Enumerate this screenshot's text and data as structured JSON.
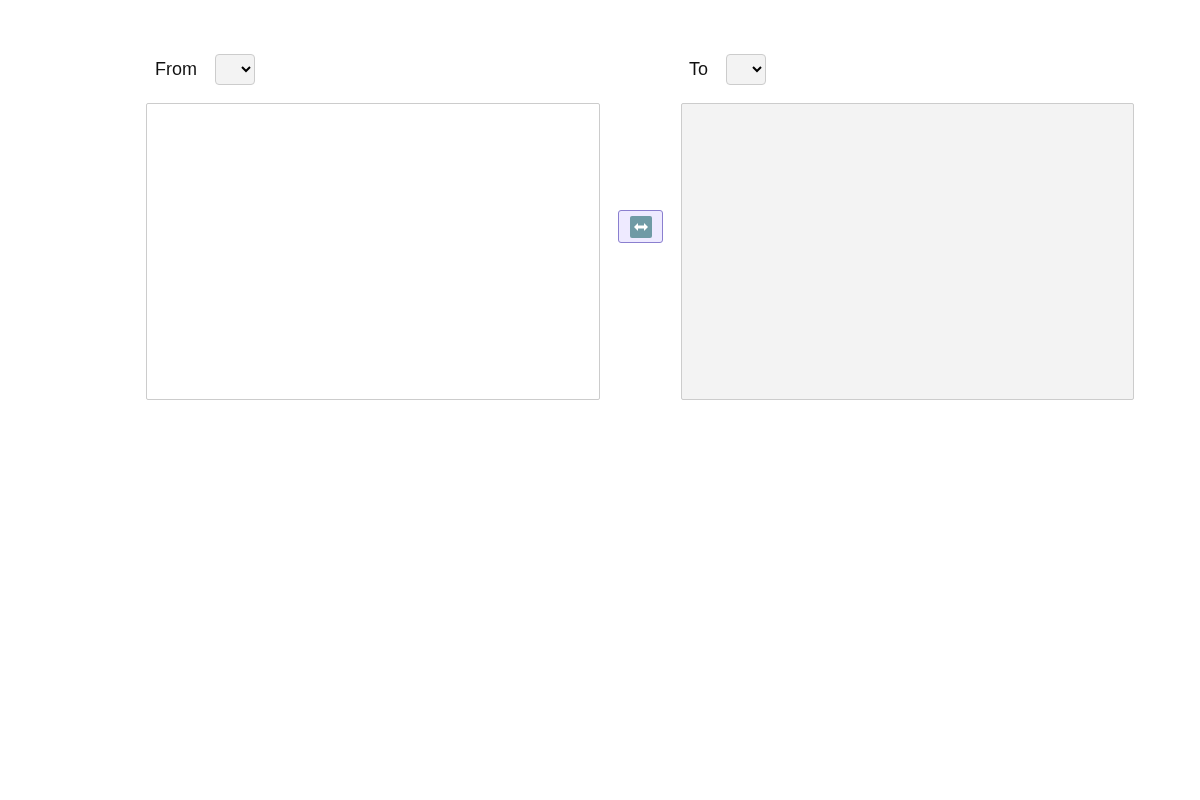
{
  "from": {
    "label": "From"
  },
  "to": {
    "label": "To"
  },
  "panels": [
    {
      "disabled": false
    },
    {
      "disabled": true
    }
  ]
}
